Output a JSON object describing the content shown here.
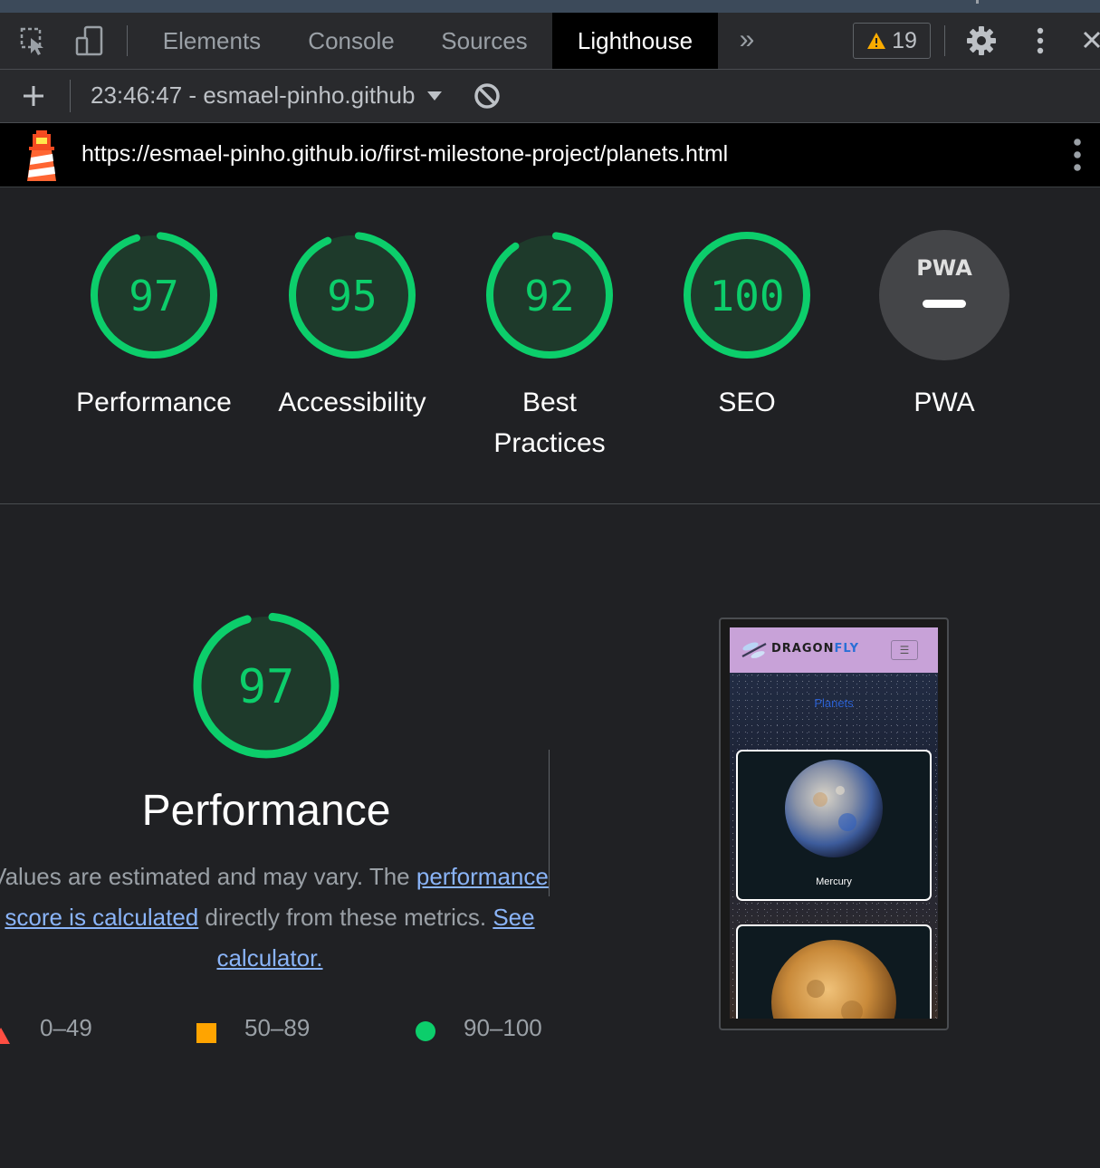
{
  "devtools": {
    "tabs": [
      "Elements",
      "Console",
      "Sources",
      "Lighthouse"
    ],
    "active_tab": "Lighthouse",
    "warning_count": "19"
  },
  "toolbar": {
    "report_select": "23:46:47 - esmael-pinho.github"
  },
  "report": {
    "url": "https://esmael-pinho.github.io/first-milestone-project/planets.html",
    "gauges": [
      {
        "score": "97",
        "label": "Performance",
        "fraction": 0.97
      },
      {
        "score": "95",
        "label": "Accessibility",
        "fraction": 0.95
      },
      {
        "score": "92",
        "label": "Best Practices",
        "fraction": 0.92
      },
      {
        "score": "100",
        "label": "SEO",
        "fraction": 1.0
      }
    ],
    "pwa": {
      "badge": "PWA",
      "label": "PWA"
    },
    "performance": {
      "score": "97",
      "fraction": 0.97,
      "title": "Performance",
      "desc_before": "Values are estimated and may vary. The ",
      "desc_link": "performance score is calculated",
      "desc_middle": " directly from these metrics. ",
      "desc_link2": "See calculator."
    },
    "legend": [
      {
        "range": "0–49",
        "color": "#ff4e42"
      },
      {
        "range": "50–89",
        "color": "#ffa400"
      },
      {
        "range": "90–100",
        "color": "#0cce6b"
      }
    ],
    "screenshot": {
      "brand_a": "DRAGON",
      "brand_b": "FLY",
      "page_title": "Planets",
      "cards": [
        "Mercury",
        ""
      ]
    }
  },
  "colors": {
    "pass": "#0cce6b",
    "pass_fill": "#1e3a2b",
    "accent_link": "#8ab4f8"
  }
}
